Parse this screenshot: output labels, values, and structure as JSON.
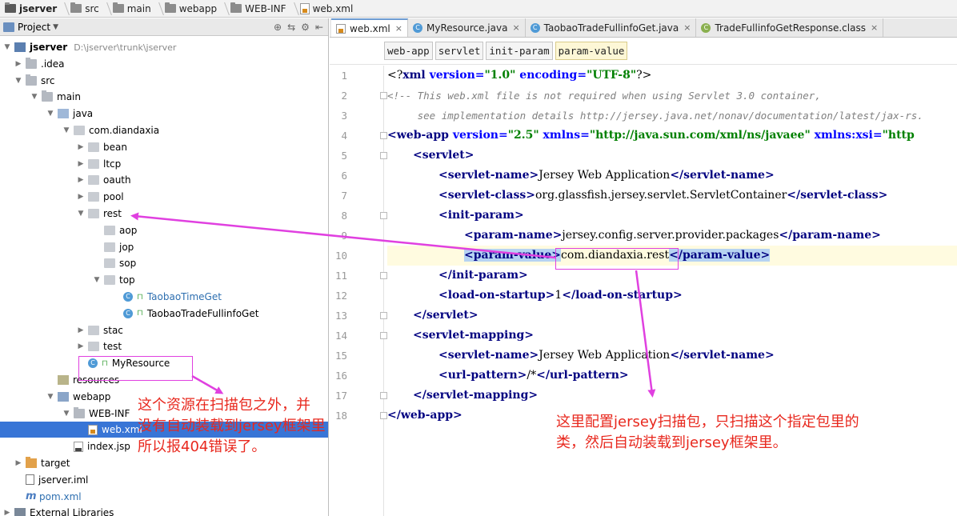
{
  "breadcrumb": {
    "items": [
      "jserver",
      "src",
      "main",
      "webapp",
      "WEB-INF",
      "web.xml"
    ]
  },
  "project_panel": {
    "title": "Project",
    "tools": [
      "⊕",
      "⇆",
      "⚙",
      "⇤"
    ],
    "tree": [
      {
        "label": "jserver",
        "path": "D:\\jserver\\trunk\\jserver",
        "icon": "module-icon",
        "arrow": "▼",
        "indent": 0,
        "bold": true
      },
      {
        "label": ".idea",
        "icon": "folder-icon",
        "arrow": "▶",
        "indent": 1
      },
      {
        "label": "src",
        "icon": "folder-icon",
        "arrow": "▼",
        "indent": 1
      },
      {
        "label": "main",
        "icon": "folder-icon",
        "arrow": "▼",
        "indent": 2
      },
      {
        "label": "java",
        "icon": "source-folder-icon",
        "arrow": "▼",
        "indent": 3
      },
      {
        "label": "com.diandaxia",
        "icon": "package-icon",
        "arrow": "▼",
        "indent": 4
      },
      {
        "label": "bean",
        "icon": "package-icon",
        "arrow": "▶",
        "indent": 5
      },
      {
        "label": "ltcp",
        "icon": "package-icon",
        "arrow": "▶",
        "indent": 5
      },
      {
        "label": "oauth",
        "icon": "package-icon",
        "arrow": "▶",
        "indent": 5
      },
      {
        "label": "pool",
        "icon": "package-icon",
        "arrow": "▶",
        "indent": 5
      },
      {
        "label": "rest",
        "icon": "package-icon",
        "arrow": "▼",
        "indent": 5
      },
      {
        "label": "aop",
        "icon": "package-icon",
        "arrow": "",
        "indent": 6
      },
      {
        "label": "jop",
        "icon": "package-icon",
        "arrow": "",
        "indent": 6
      },
      {
        "label": "sop",
        "icon": "package-icon",
        "arrow": "",
        "indent": 6
      },
      {
        "label": "top",
        "icon": "package-icon",
        "arrow": "▼",
        "indent": 6
      },
      {
        "label": "TaobaoTimeGet",
        "icon": "class-icon",
        "arrow": "",
        "indent": 7,
        "blue": true
      },
      {
        "label": "TaobaoTradeFullinfoGet",
        "icon": "class-icon",
        "arrow": "",
        "indent": 7
      },
      {
        "label": "stac",
        "icon": "package-icon",
        "arrow": "▶",
        "indent": 5
      },
      {
        "label": "test",
        "icon": "package-icon",
        "arrow": "▶",
        "indent": 5
      },
      {
        "label": "MyResource",
        "icon": "class-icon",
        "arrow": "",
        "indent": 5
      },
      {
        "label": "resources",
        "icon": "resources-folder-icon",
        "arrow": "",
        "indent": 3
      },
      {
        "label": "webapp",
        "icon": "web-folder-icon",
        "arrow": "▼",
        "indent": 3
      },
      {
        "label": "WEB-INF",
        "icon": "folder-icon",
        "arrow": "▼",
        "indent": 4
      },
      {
        "label": "web.xml",
        "icon": "xml-file-icon",
        "arrow": "",
        "indent": 5,
        "selected": true
      },
      {
        "label": "index.jsp",
        "icon": "jsp-file-icon",
        "arrow": "",
        "indent": 4
      },
      {
        "label": "target",
        "icon": "target-folder-icon",
        "arrow": "▶",
        "indent": 1
      },
      {
        "label": "jserver.iml",
        "icon": "iml-file-icon",
        "arrow": "",
        "indent": 1
      },
      {
        "label": "pom.xml",
        "icon": "maven-icon",
        "arrow": "",
        "indent": 1,
        "blue": true
      },
      {
        "label": "External Libraries",
        "icon": "library-icon",
        "arrow": "▶",
        "indent": 0
      }
    ]
  },
  "editor": {
    "tabs": [
      {
        "label": "web.xml",
        "icon": "xml-file-icon",
        "active": true
      },
      {
        "label": "MyResource.java",
        "icon": "class-icon"
      },
      {
        "label": "TaobaoTradeFullinfoGet.java",
        "icon": "class-icon"
      },
      {
        "label": "TradeFullinfoGetResponse.class",
        "icon": "compiled-class-icon"
      }
    ],
    "tab_close": "×",
    "xml_path": [
      "web-app",
      "servlet",
      "init-param",
      "param-value"
    ],
    "line_numbers": [
      "1",
      "2",
      "3",
      "4",
      "5",
      "6",
      "7",
      "8",
      "9",
      "10",
      "11",
      "12",
      "13",
      "14",
      "15",
      "16",
      "17",
      "18"
    ],
    "code": {
      "l1": {
        "a": "<?",
        "b": "xml",
        "c": " version=",
        "d": "\"1.0\"",
        "e": " encoding=",
        "f": "\"UTF-8\"",
        "g": "?>"
      },
      "l2": "<!-- This web.xml file is not required when using Servlet 3.0 container,",
      "l3": "     see implementation details http://jersey.java.net/nonav/documentation/latest/jax-rs.",
      "l4": {
        "a": "<web-app",
        "b": " version=",
        "c": "\"2.5\"",
        "d": " xmlns=",
        "e": "\"http://java.sun.com/xml/ns/javaee\"",
        "f": " xmlns:xsi=",
        "g": "\"http"
      },
      "l5": "<servlet>",
      "l6": {
        "a": "<servlet-name>",
        "b": "Jersey Web Application",
        "c": "</servlet-name>"
      },
      "l7": {
        "a": "<servlet-class>",
        "b": "org.glassfish.jersey.servlet.ServletContainer",
        "c": "</servlet-class>"
      },
      "l8": "<init-param>",
      "l9": {
        "a": "<param-name>",
        "b": "jersey.config.server.provider.packages",
        "c": "</param-name>"
      },
      "l10": {
        "a": "<param-value>",
        "b": "com.diandaxia.rest",
        "c": "</param-value>"
      },
      "l11": "</init-param>",
      "l12": {
        "a": "<load-on-startup>",
        "b": "1",
        "c": "</load-on-startup>"
      },
      "l13": "</servlet>",
      "l14": "<servlet-mapping>",
      "l15": {
        "a": "<servlet-name>",
        "b": "Jersey Web Application",
        "c": "</servlet-name>"
      },
      "l16": {
        "a": "<url-pattern>",
        "b": "/*",
        "c": "</url-pattern>"
      },
      "l17": "</servlet-mapping>",
      "l18": "</web-app>"
    }
  },
  "annotations": {
    "left_note": [
      "这个资源在扫描包之外，并",
      "没有自动装载到jersey框架里",
      "所以报404错误了。"
    ],
    "right_note": [
      "这里配置jersey扫描包，只扫描这个指定包里的",
      "类，然后自动装载到jersey框架里。"
    ],
    "color": "#e8281e",
    "arrow_color": "#e040e0"
  }
}
